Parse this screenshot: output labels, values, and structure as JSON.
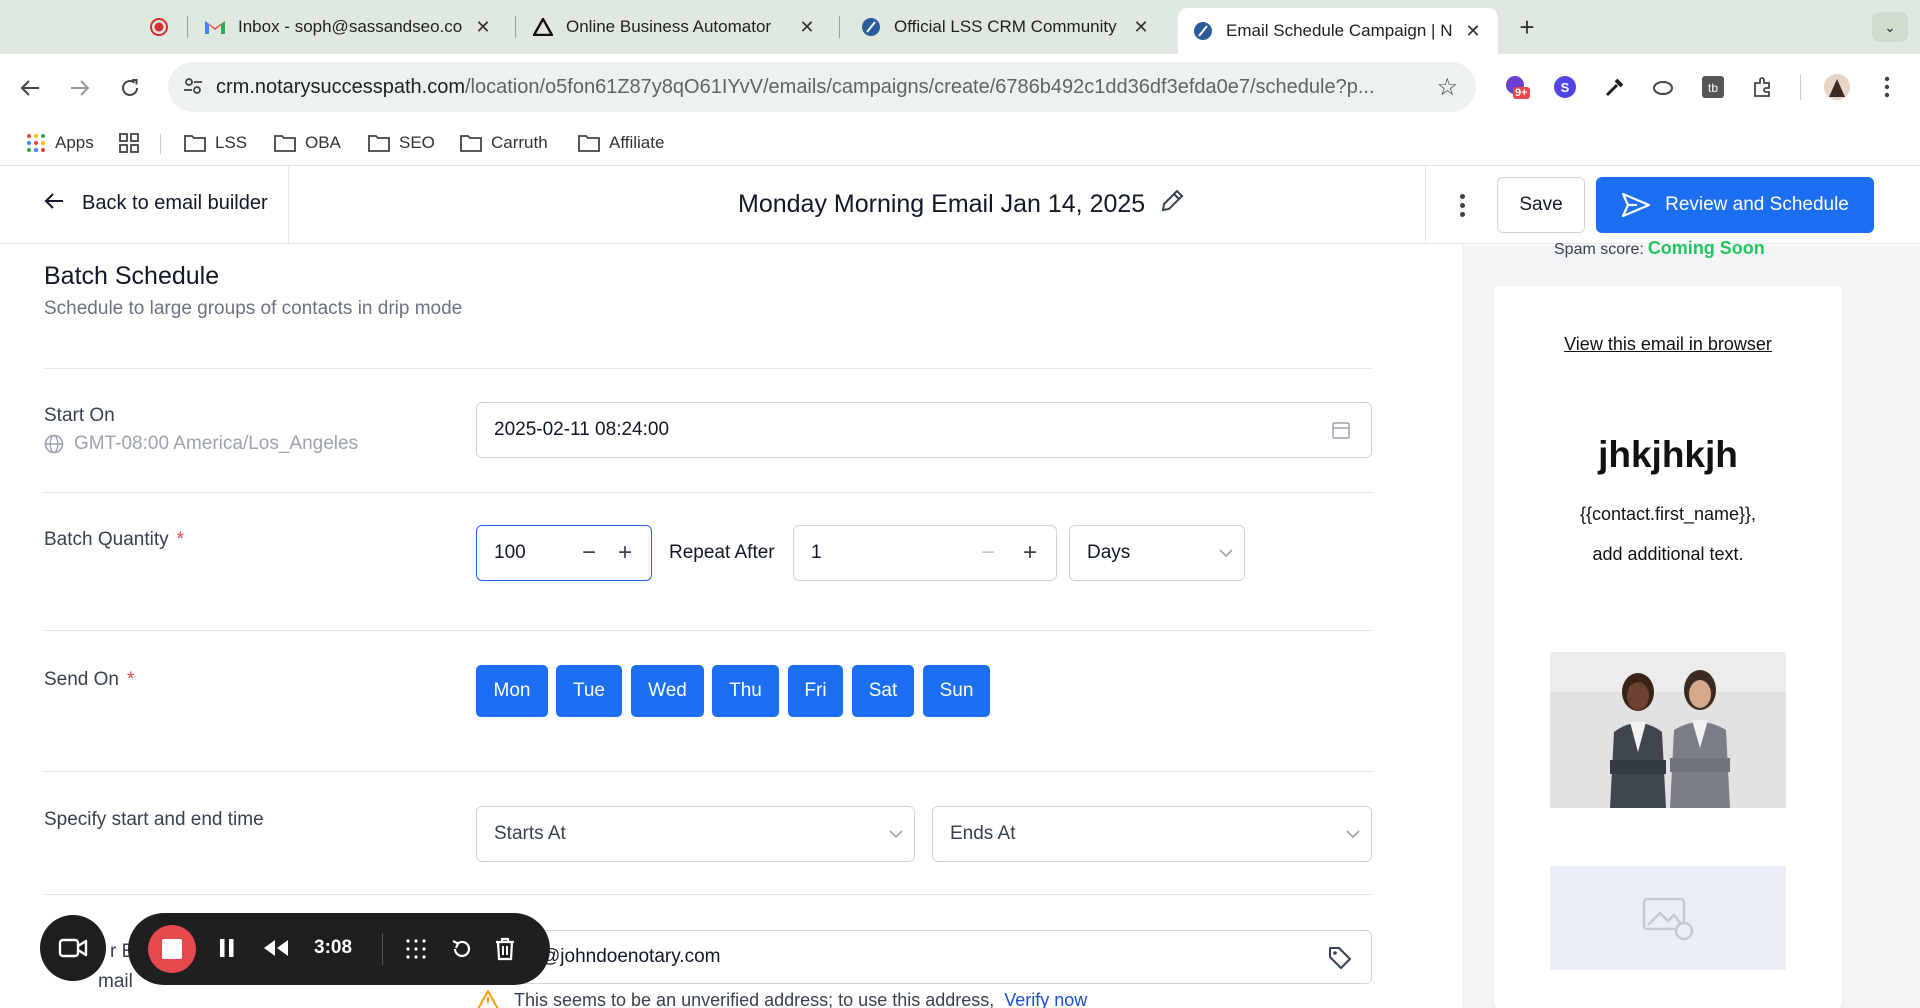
{
  "browser": {
    "tabs": [
      {
        "title": "",
        "icon": "record-icon",
        "active": false
      },
      {
        "title": "Inbox - soph@sassandseo.co",
        "icon": "gmail-icon",
        "active": false
      },
      {
        "title": "Online Business Automator",
        "icon": "automator-icon",
        "active": false
      },
      {
        "title": "Official LSS CRM Community",
        "icon": "crm-icon",
        "active": false
      },
      {
        "title": "Email Schedule Campaign | N",
        "icon": "crm-icon",
        "active": true
      }
    ],
    "url_main": "crm.notarysuccesspath.com",
    "url_path": "/location/o5fon61Z87y8qO61IYvV/emails/campaigns/create/6786b492c1dd36df3efda0e7/schedule?p...",
    "extension_badge": "9+",
    "bookmarks": [
      "Apps",
      "LSS",
      "OBA",
      "SEO",
      "Carruth",
      "Affiliate"
    ]
  },
  "header": {
    "back_label": "Back to email builder",
    "campaign_title": "Monday Morning Email Jan 14, 2025",
    "save_label": "Save",
    "review_label": "Review and Schedule"
  },
  "form": {
    "section_title": "Batch Schedule",
    "section_subtitle": "Schedule to large groups of contacts in drip mode",
    "start_on_label": "Start On",
    "timezone": "GMT-08:00 America/Los_Angeles",
    "start_datetime": "2025-02-11 08:24:00",
    "batch_quantity_label": "Batch Quantity",
    "required_mark": "*",
    "batch_quantity_value": "100",
    "repeat_after_label": "Repeat After",
    "repeat_after_value": "1",
    "repeat_unit": "Days",
    "send_on_label": "Send On",
    "days": [
      "Mon",
      "Tue",
      "Wed",
      "Thu",
      "Fri",
      "Sat",
      "Sun"
    ],
    "time_label": "Specify start and end time",
    "starts_placeholder": "Starts At",
    "ends_placeholder": "Ends At",
    "from_label_partial": "r E",
    "from_label_partial2": "mail",
    "from_email_partial": "@johndoenotary.com",
    "warning_text": "This seems to be an unverified address; to use this address,",
    "verify_link": "Verify now"
  },
  "preview": {
    "spam_label": "Spam score:",
    "spam_value": "Coming Soon",
    "view_in_browser": "View this email in browser",
    "heading": "jhkjhkjh",
    "line1": "{{contact.first_name}},",
    "line2": "add additional text."
  },
  "recorder": {
    "time": "3:08"
  },
  "colors": {
    "primary": "#1d6ff2",
    "spam_ok": "#22c55e",
    "required": "#ef4444",
    "recorder_stop": "#e5484d"
  }
}
